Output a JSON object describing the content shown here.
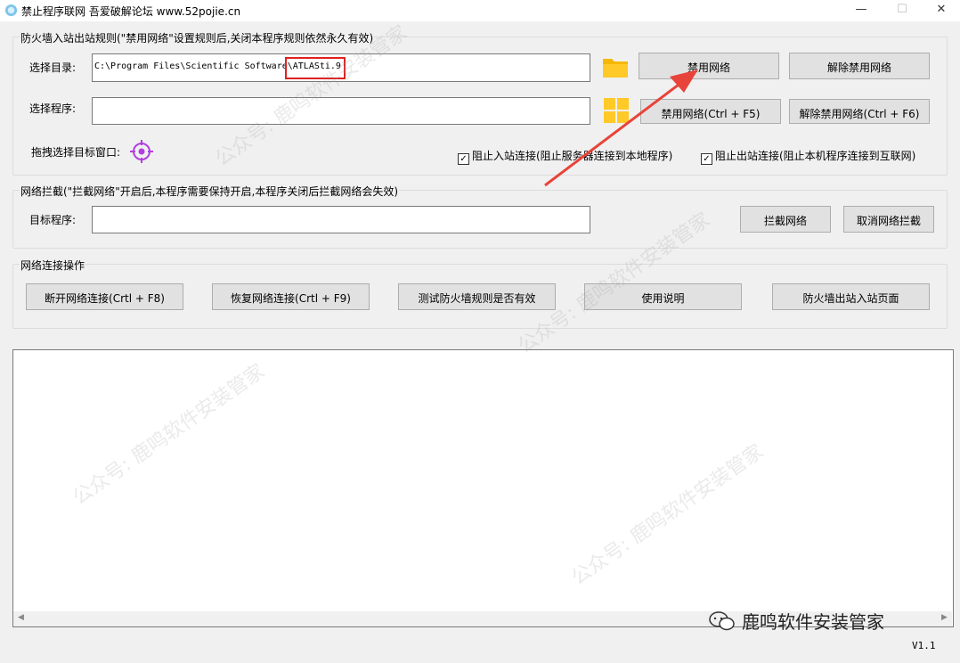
{
  "window": {
    "title": "禁止程序联网 吾爱破解论坛 www.52pojie.cn",
    "controls": {
      "minimize": "—",
      "maximize": "☐",
      "close": "✕"
    }
  },
  "firewall_group": {
    "title": "防火墙入站出站规则(\"禁用网络\"设置规则后,关闭本程序规则依然永久有效)",
    "select_dir_label": "选择目录:",
    "dir_path_prefix": "C:\\Program Files\\Scientific Software",
    "dir_path_highlight": "\\ATLASti.9",
    "select_program_label": "选择程序:",
    "program_value": "",
    "drag_target_label": "拖拽选择目标窗口:",
    "disable_network_btn": "禁用网络",
    "enable_network_btn": "解除禁用网络",
    "disable_network_hotkey_btn": "禁用网络(Ctrl + F5)",
    "enable_network_hotkey_btn": "解除禁用网络(Ctrl + F6)",
    "block_inbound_label": "阻止入站连接(阻止服务器连接到本地程序)",
    "block_inbound_checked": true,
    "block_outbound_label": "阻止出站连接(阻止本机程序连接到互联网)",
    "block_outbound_checked": true
  },
  "intercept_group": {
    "title": "网络拦截(\"拦截网络\"开启后,本程序需要保持开启,本程序关闭后拦截网络会失效)",
    "target_label": "目标程序:",
    "target_value": "",
    "intercept_btn": "拦截网络",
    "cancel_intercept_btn": "取消网络拦截"
  },
  "connection_group": {
    "title": "网络连接操作",
    "buttons": [
      "断开网络连接(Crtl + F8)",
      "恢复网络连接(Crtl + F9)",
      "测试防火墙规则是否有效",
      "使用说明",
      "防火墙出站入站页面"
    ]
  },
  "log": {
    "content": ""
  },
  "version": "V1.1",
  "overlay": {
    "brand": "鹿鸣软件安装管家",
    "watermark_text": "公众号: 鹿鸣软件安装管家",
    "arrow_color": "#e8433a",
    "highlight_color": "#e02020"
  }
}
